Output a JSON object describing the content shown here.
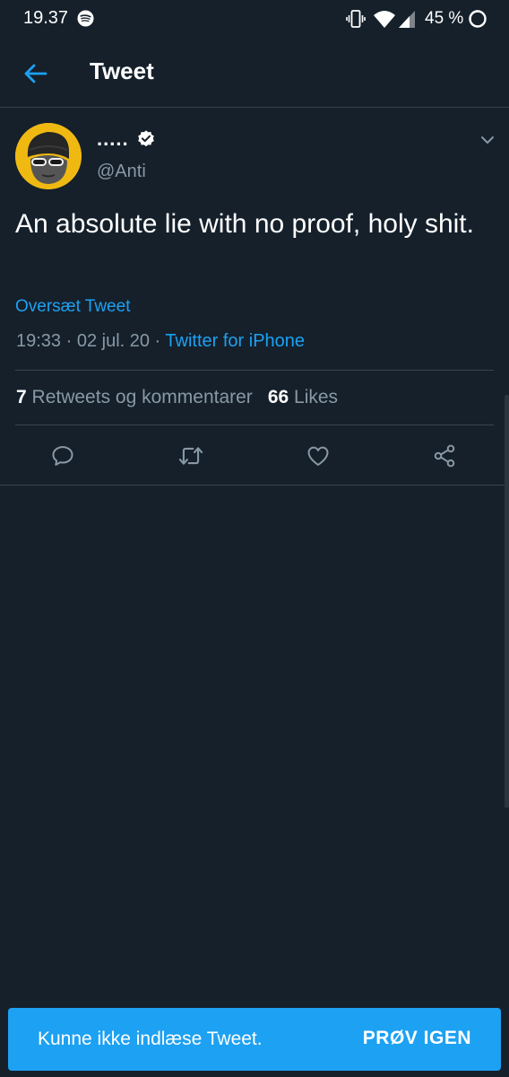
{
  "status_bar": {
    "time": "19.37",
    "battery_text": "45 %",
    "icons": [
      "spotify-icon",
      "vibrate-icon",
      "wifi-icon",
      "cell-signal-icon",
      "battery-icon"
    ]
  },
  "header": {
    "title": "Tweet",
    "back_icon": "arrow-left-icon"
  },
  "tweet": {
    "display_name": ".....",
    "handle": "@Anti",
    "verified": true,
    "text": "An absolute lie with no proof, holy shit.",
    "translate_label": "Oversæt Tweet",
    "timestamp": "19:33 · 02 jul. 20 · ",
    "source": "Twitter for iPhone",
    "stats": {
      "retweets_count": "7",
      "retweets_label": "Retweets og kommentarer",
      "likes_count": "66",
      "likes_label": "Likes"
    },
    "actions": [
      "reply-icon",
      "retweet-icon",
      "like-icon",
      "share-icon"
    ]
  },
  "snackbar": {
    "message": "Kunne ikke indlæse Tweet.",
    "action_label": "PRØV IGEN"
  },
  "colors": {
    "background": "#15202b",
    "accent": "#1da1f2",
    "secondary_text": "#8899a6",
    "divider": "#38444d"
  }
}
